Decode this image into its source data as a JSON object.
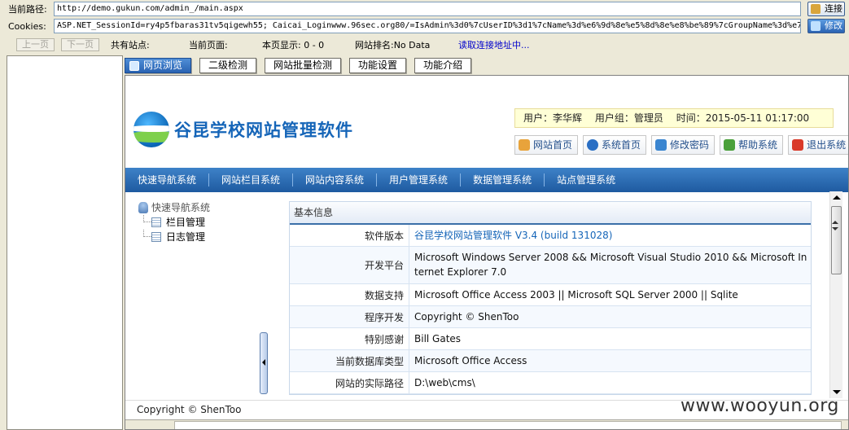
{
  "toolbar": {
    "path_label": "当前路径:",
    "path_value": "http://demo.gukun.com/admin_/main.aspx",
    "connect_label": "连接",
    "cookies_label": "Cookies:",
    "cookies_value": "ASP.NET_SessionId=ry4p5fbaras31tv5qigewh55; Caicai_Loginwww.96sec.org80/=IsAdmin%3d0%7cUserID%3d1%7cName%3d%e6%9d%8e%e5%8d%8e%e8%be%89%7cGroupName%3d%e7",
    "modify_label": "修改"
  },
  "navrow": {
    "prev_label": "上一页",
    "next_label": "下一页",
    "total_sites": "共有站点:",
    "current_page": "当前页面:",
    "page_display": "本页显示: 0 - 0",
    "site_rank": "网站排名:No Data",
    "reading": "读取连接地址中..."
  },
  "tabs": [
    {
      "label": "网页浏览"
    },
    {
      "label": "二级检测"
    },
    {
      "label": "网站批量检测"
    },
    {
      "label": "功能设置"
    },
    {
      "label": "功能介绍"
    }
  ],
  "site": {
    "logo_text": "谷昆学校网站管理软件",
    "user_info": {
      "user": "用户：李华辉",
      "group": "用户组：管理员",
      "time": "时间：2015-05-11 01:17:00"
    },
    "quick_buttons": [
      {
        "label": "网站首页",
        "icon": "home-icon",
        "color": "#e8a33b"
      },
      {
        "label": "系统首页",
        "icon": "info-icon",
        "color": "#2a6fc4"
      },
      {
        "label": "修改密码",
        "icon": "key-icon",
        "color": "#3a85d0"
      },
      {
        "label": "帮助系统",
        "icon": "help-icon",
        "color": "#4aa03a"
      },
      {
        "label": "退出系统",
        "icon": "exit-icon",
        "color": "#d93a2a"
      }
    ],
    "main_nav": [
      "快速导航系统",
      "网站栏目系统",
      "网站内容系统",
      "用户管理系统",
      "数据管理系统",
      "站点管理系统"
    ],
    "tree": {
      "root": "快速导航系统",
      "children": [
        "栏目管理",
        "日志管理"
      ]
    },
    "info": {
      "header": "基本信息",
      "rows": [
        {
          "key": "软件版本",
          "value": "谷昆学校网站管理软件 V3.4 (build 131028)"
        },
        {
          "key": "开发平台",
          "value": "Microsoft Windows Server 2008 && Microsoft Visual Studio 2010 && Microsoft Internet Explorer 7.0"
        },
        {
          "key": "数据支持",
          "value": "Microsoft Office Access 2003 || Microsoft SQL Server 2000 || Sqlite"
        },
        {
          "key": "程序开发",
          "value": "Copyright © ShenToo"
        },
        {
          "key": "特别感谢",
          "value": "Bill Gates"
        },
        {
          "key": "当前数据库类型",
          "value": "Microsoft Office Access"
        },
        {
          "key": "网站的实际路径",
          "value": "D:\\web\\cms\\"
        }
      ]
    },
    "footer": "Copyright © ShenToo"
  },
  "watermark": "www.wooyun.org"
}
